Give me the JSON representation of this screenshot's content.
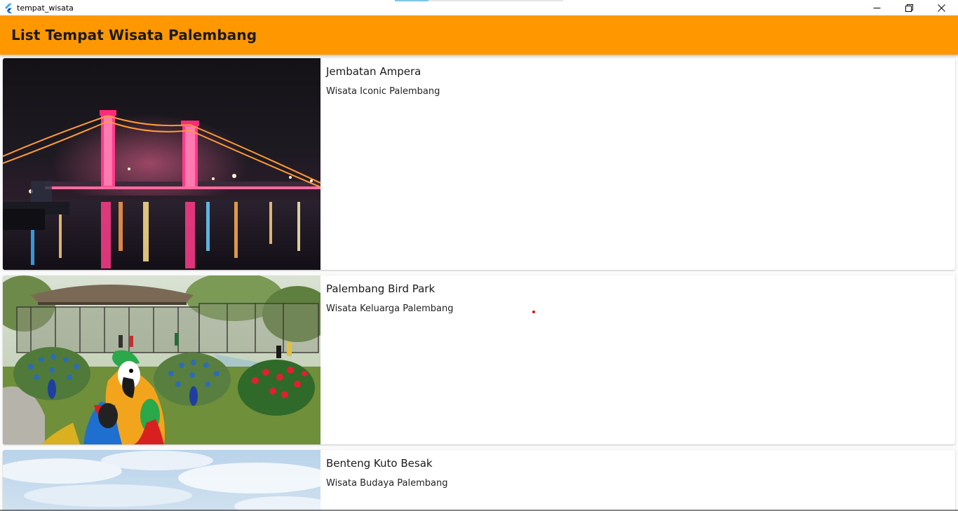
{
  "window": {
    "title": "tempat_wisata",
    "icons": {
      "app": "flutter-logo-icon",
      "minimize": "minimize-icon",
      "maximize": "restore-icon",
      "close": "close-icon"
    }
  },
  "appbar": {
    "title": "List Tempat Wisata Palembang",
    "color": "#ff9800"
  },
  "places": [
    {
      "title": "Jembatan Ampera",
      "subtitle": "Wisata Iconic Palembang",
      "image": "night-bridge-photo"
    },
    {
      "title": "Palembang Bird Park",
      "subtitle": "Wisata Keluarga Palembang",
      "image": "bird-park-photo"
    },
    {
      "title": "Benteng Kuto Besak",
      "subtitle": "Wisata Budaya Palembang",
      "image": "sky-fort-photo"
    }
  ]
}
